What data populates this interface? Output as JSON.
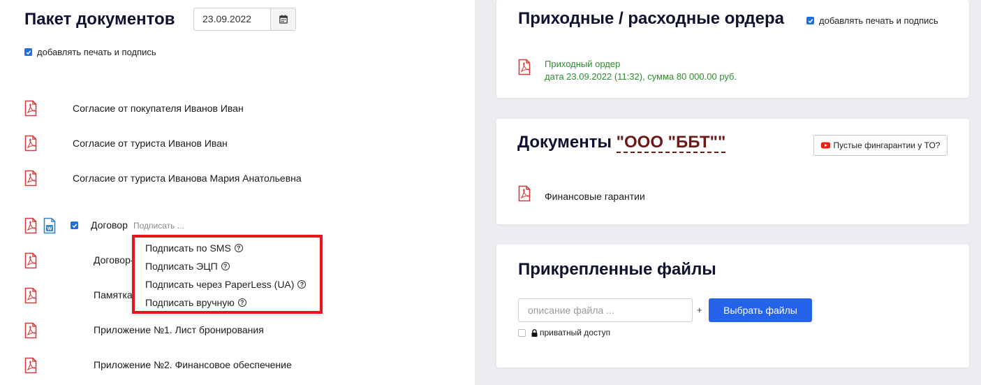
{
  "left": {
    "title": "Пакет документов",
    "date_value": "23.09.2022",
    "stamp_option": "добавлять печать и подпись",
    "documents": [
      "Согласие от покупателя Иванов Иван",
      "Согласие от туриста Иванов Иван",
      "Согласие от туриста Иванова Мария Анатольевна"
    ],
    "contract_label": "Договор",
    "sign_link": "Подписать ...",
    "sub_documents": [
      "Договор-",
      "Памятка",
      "Приложение №1. Лист бронирования",
      "Приложение №2. Финансовое обеспечение"
    ],
    "sign_menu": [
      "Подписать по SMS",
      "Подписать ЭЦП",
      "Подписать через PaperLess (UA)",
      "Подписать вручную"
    ],
    "help_glyph": "?",
    "word_glyph": "W"
  },
  "orders": {
    "title": "Приходные / расходные ордера",
    "stamp_option": "добавлять печать и подпись",
    "item_title": "Приходный ордер",
    "item_detail": "дата 23.09.2022 (11:32), сумма 80 000.00 руб."
  },
  "company_docs": {
    "title_prefix": "Документы",
    "company": "\"ООО \"ББТ\"\"",
    "button_label": "Пустые фингарантии у ТО?",
    "item": "Финансовые гарантии"
  },
  "attachments": {
    "title": "Прикрепленные файлы",
    "input_placeholder": "описание файла ...",
    "plus": "+",
    "choose_button": "Выбрать файлы",
    "private_label": "приватный доступ"
  },
  "colors": {
    "accent": "#2563eb",
    "popup_border": "#e8151b",
    "pdf_red": "#d63a3a",
    "order_green": "#2e8b2e",
    "company_color": "#6b1a1a"
  }
}
